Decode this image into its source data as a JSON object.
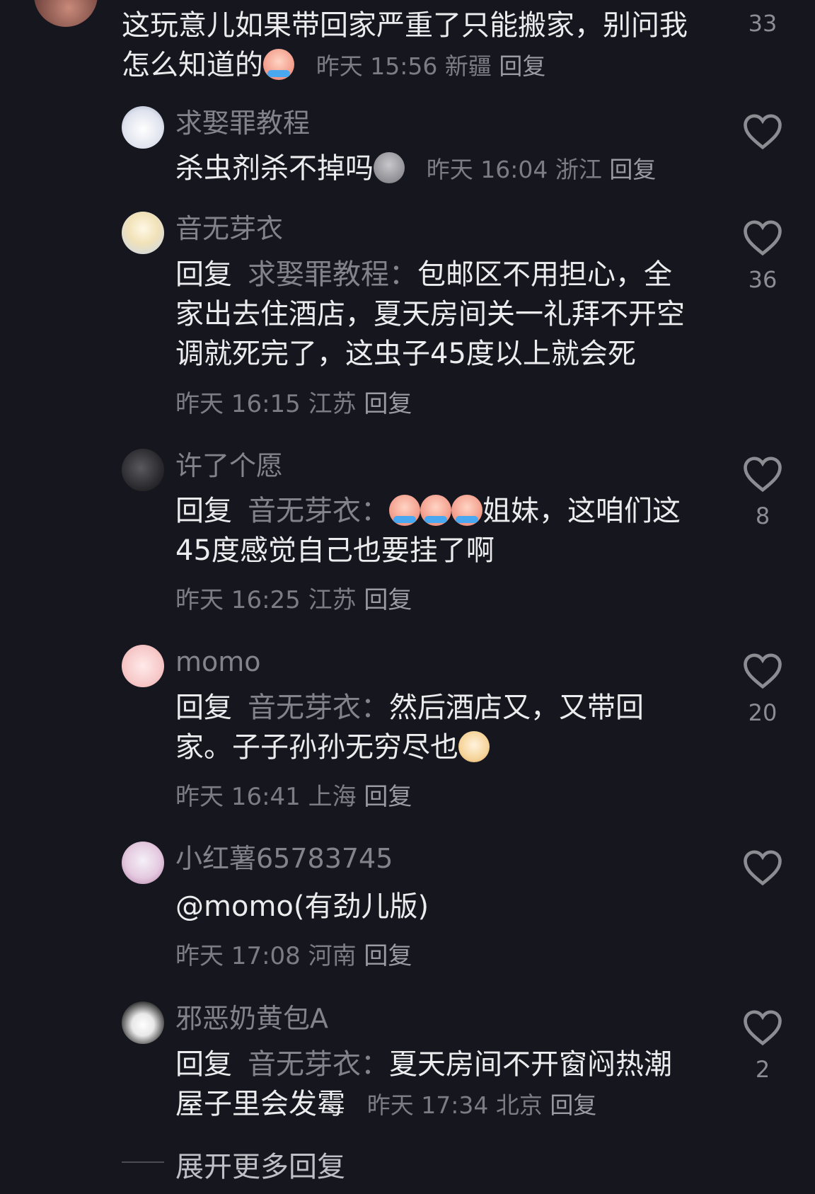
{
  "parent_comment": {
    "text": "这玩意儿如果带回家严重了只能搬家，别问我怎么知道的",
    "emoji": "crying-emoji",
    "time": "昨天 15:56",
    "location": "新疆",
    "reply_label": "回复",
    "likes": "33"
  },
  "replies": [
    {
      "username": "求娶罪教程",
      "text": "杀虫剂杀不掉吗",
      "emoji": "grey-face-emoji",
      "time": "昨天 16:04",
      "location": "浙江",
      "reply_label": "回复",
      "likes": ""
    },
    {
      "username": "音无芽衣",
      "reply_prefix": "回复",
      "reply_to": "求娶罪教程：",
      "text": "包邮区不用担心，全家出去住酒店，夏天房间关一礼拜不开空调就死完了，这虫子45度以上就会死",
      "time": "昨天 16:15",
      "location": "江苏",
      "reply_label": "回复",
      "likes": "36"
    },
    {
      "username": "许了个愿",
      "reply_prefix": "回复",
      "reply_to": "音无芽衣：",
      "emojis": [
        "crying-emoji",
        "crying-emoji",
        "crying-emoji"
      ],
      "text": "姐妹，这咱们这45度感觉自己也要挂了啊",
      "time": "昨天 16:25",
      "location": "江苏",
      "reply_label": "回复",
      "likes": "8"
    },
    {
      "username": "momo",
      "reply_prefix": "回复",
      "reply_to": "音无芽衣：",
      "text": "然后酒店又，又带回家。子子孙孙无穷尽也",
      "emoji": "dog-emoji",
      "time": "昨天 16:41",
      "location": "上海",
      "reply_label": "回复",
      "likes": "20"
    },
    {
      "username": "小红薯65783745",
      "text": "@momo(有劲儿版)",
      "time": "昨天 17:08",
      "location": "河南",
      "reply_label": "回复",
      "likes": ""
    },
    {
      "username": "邪恶奶黄包A",
      "reply_prefix": "回复",
      "reply_to": "音无芽衣：",
      "text": "夏天房间不开窗闷热潮屋子里会发霉",
      "time": "昨天 17:34",
      "location": "北京",
      "reply_label": "回复",
      "likes": "2"
    }
  ],
  "expand_more": "展开更多回复",
  "colors": {
    "background": "#16161e",
    "text_primary": "#ececee",
    "text_secondary": "#83838b",
    "meta": "#7c7c84"
  }
}
